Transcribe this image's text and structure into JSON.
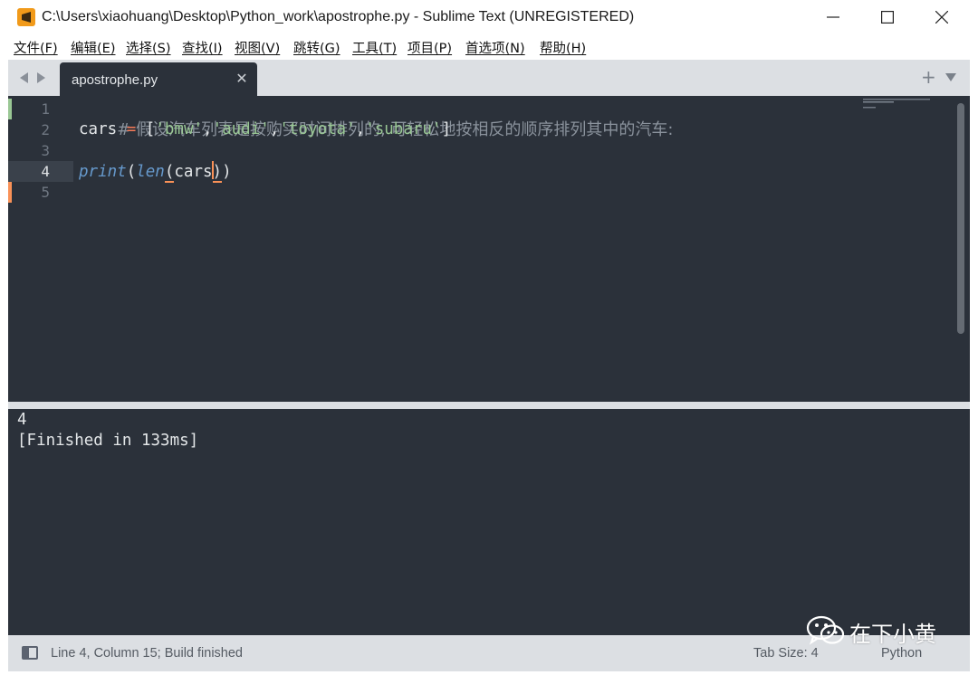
{
  "window": {
    "title": "C:\\Users\\xiaohuang\\Desktop\\Python_work\\apostrophe.py - Sublime Text (UNREGISTERED)",
    "app_icon": "sublime-text-logo",
    "controls": [
      "minimize-icon",
      "maximize-icon",
      "close-icon"
    ]
  },
  "menu": [
    "文件(F)",
    "编辑(E)",
    "选择(S)",
    "查找(I)",
    "视图(V)",
    "跳转(G)",
    "工具(T)",
    "项目(P)",
    "首选项(N)",
    "帮助(H)"
  ],
  "tabs": [
    {
      "label": "apostrophe.py",
      "active": true,
      "close_icon": "close-icon"
    }
  ],
  "editor": {
    "line_numbers": [
      "1",
      "2",
      "3",
      "4",
      "5"
    ],
    "current_line": "4",
    "lines": {
      "l1_comment": "# 假设汽车列表是按购买时间排列的, 可轻松地按相反的顺序排列其中的汽车:",
      "l2_var": "cars",
      "l2_eq": "=",
      "l2_open": "[",
      "l2_s1": "'bmw'",
      "l2_c1": ",",
      "l2_s2": "'audi'",
      "l2_c2": ",",
      "l2_s3": "'toyota'",
      "l2_c3": ",",
      "l2_s4": "'subaru'",
      "l2_close": "]",
      "l4_print": "print",
      "l4_p1": "(",
      "l4_len": "len",
      "l4_p2": "(",
      "l4_arg_a": "cars",
      "l4_p3": ")",
      "l4_p4": ")"
    },
    "colors": {
      "background": "#2b313a",
      "comment": "#8a929c",
      "string": "#99c794",
      "operator": "#f97b58",
      "function": "#6699cc",
      "caret": "#f99157"
    }
  },
  "output": {
    "lines": [
      "4",
      "[Finished in 133ms]"
    ]
  },
  "statusbar": {
    "position": "Line 4, Column 15; Build finished",
    "tab_size": "Tab Size: 4",
    "syntax": "Python"
  },
  "watermark": {
    "icon": "wechat-icon",
    "text": "在下小黄"
  }
}
